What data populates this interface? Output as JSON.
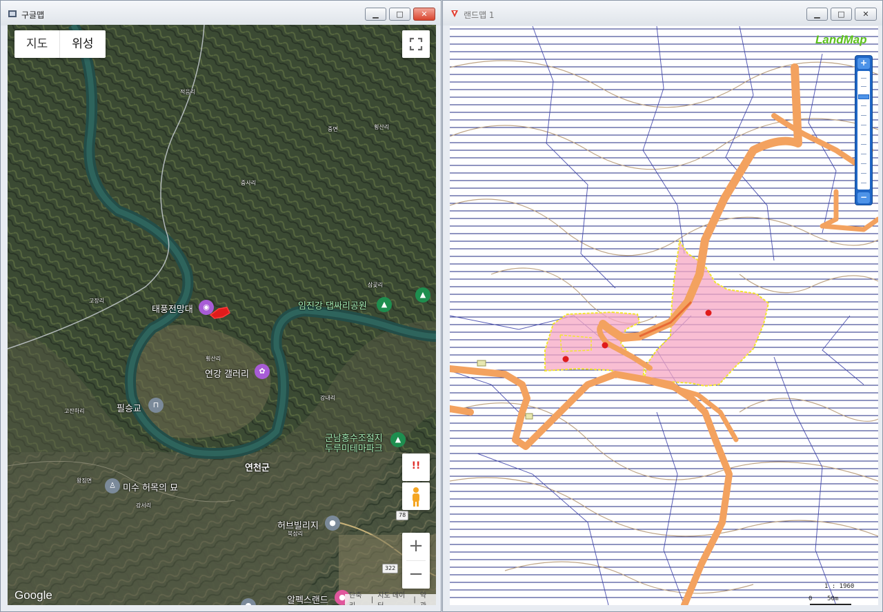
{
  "left_window": {
    "title": "구글맵",
    "controls": {
      "minimize": "▁",
      "maximize": "□",
      "close": "✕"
    },
    "map_type": {
      "map": "지도",
      "satellite": "위성",
      "active": "위성"
    },
    "labels": {
      "jeokgeori": "적음리",
      "jungmyeon": "중면",
      "hoengsanri": "횡산리",
      "jungsari": "중사리",
      "gojangri": "고장리",
      "samgotri": "삼곶리",
      "hoengsanri2": "횡산리",
      "ganghari": "강내리",
      "gojanhari": "고잔하리",
      "wangjing": "왕징면",
      "gangseori": "강서리",
      "buksamri": "북삼리",
      "taepung": "태풍전망대",
      "yeongang": "연강 갤러리",
      "imjingang": "임진강 댑싸리공원",
      "pilseunggyo": "필승교",
      "gunnam1": "군남홍수조절지",
      "gunnam2": "두루미테마파크",
      "yeoncheon": "연천군",
      "misu": "미수 허목의 묘",
      "herbvillage": "허브빌리지",
      "alpaca": "알펙스랜드"
    },
    "route_shields": {
      "r78": "78",
      "r322": "322"
    },
    "google_logo": "Google",
    "footer": {
      "shortcuts": "단축키",
      "map_data": "지도 데이터",
      "terms": "약관"
    },
    "zoom_in": "+",
    "zoom_out": "−",
    "warning_label": "!!"
  },
  "right_window": {
    "title": "랜드맵 1",
    "controls": {
      "minimize": "▁",
      "maximize": "□",
      "close": "✕"
    },
    "logo": "LandMap",
    "zoom_plus": "+",
    "zoom_minus": "−",
    "scale_text": "1 : 1960",
    "scale_bar": "0    50m"
  }
}
